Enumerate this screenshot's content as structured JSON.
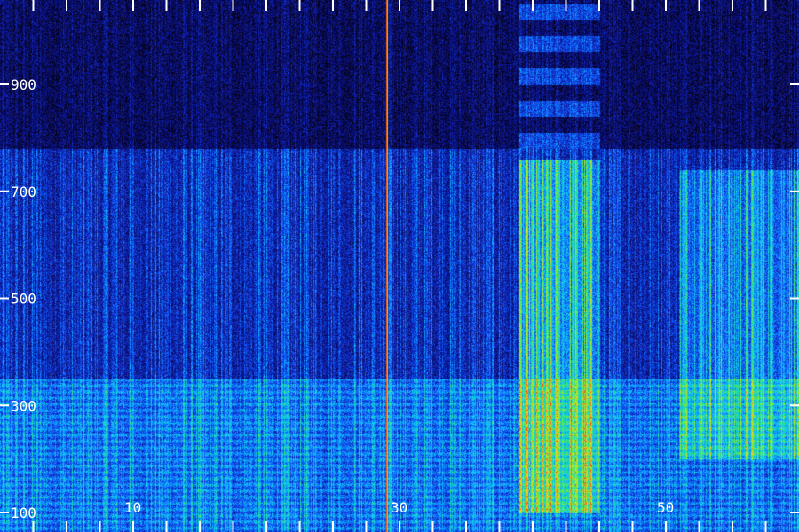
{
  "chart_data": {
    "type": "heatmap",
    "title": "",
    "xlabel": "",
    "ylabel": "",
    "xlim": [
      0,
      60
    ],
    "ylim": [
      100,
      1080
    ],
    "y_ticks": [
      {
        "value": 900,
        "label": "900"
      },
      {
        "value": 700,
        "label": "700"
      },
      {
        "value": 500,
        "label": "500"
      },
      {
        "value": 300,
        "label": "300"
      },
      {
        "value": 100,
        "label": "100"
      }
    ],
    "x_ticks": [
      {
        "value": 10,
        "label": "10"
      },
      {
        "value": 30,
        "label": "30"
      },
      {
        "value": 50,
        "label": "50"
      }
    ],
    "x_minor_ticks": [
      2.5,
      5,
      7.5,
      10,
      12.5,
      15,
      17.5,
      20,
      22.5,
      25,
      27.5,
      30,
      32.5,
      35,
      37.5,
      40,
      42.5,
      45,
      47.5,
      50,
      52.5,
      55,
      57.5
    ],
    "colormap": [
      "#000000",
      "#0a0a5a",
      "#1020b0",
      "#1060ff",
      "#10c0ff",
      "#20e0a0",
      "#90f020",
      "#ffd020",
      "#ff4000"
    ],
    "features": [
      {
        "kind": "broadband-band",
        "freq_range": [
          100,
          350
        ],
        "intensity": 0.55
      },
      {
        "kind": "dark-gap",
        "freq_range": [
          780,
          1080
        ],
        "intensity": 0.12
      },
      {
        "kind": "strong-line",
        "x": 29,
        "intensity": 1.0
      },
      {
        "kind": "bright-region",
        "time_range": [
          39,
          45
        ],
        "freq_range": [
          100,
          760
        ],
        "intensity": 0.8
      },
      {
        "kind": "bright-region",
        "time_range": [
          51,
          60
        ],
        "freq_range": [
          200,
          740
        ],
        "intensity": 0.6
      }
    ]
  }
}
